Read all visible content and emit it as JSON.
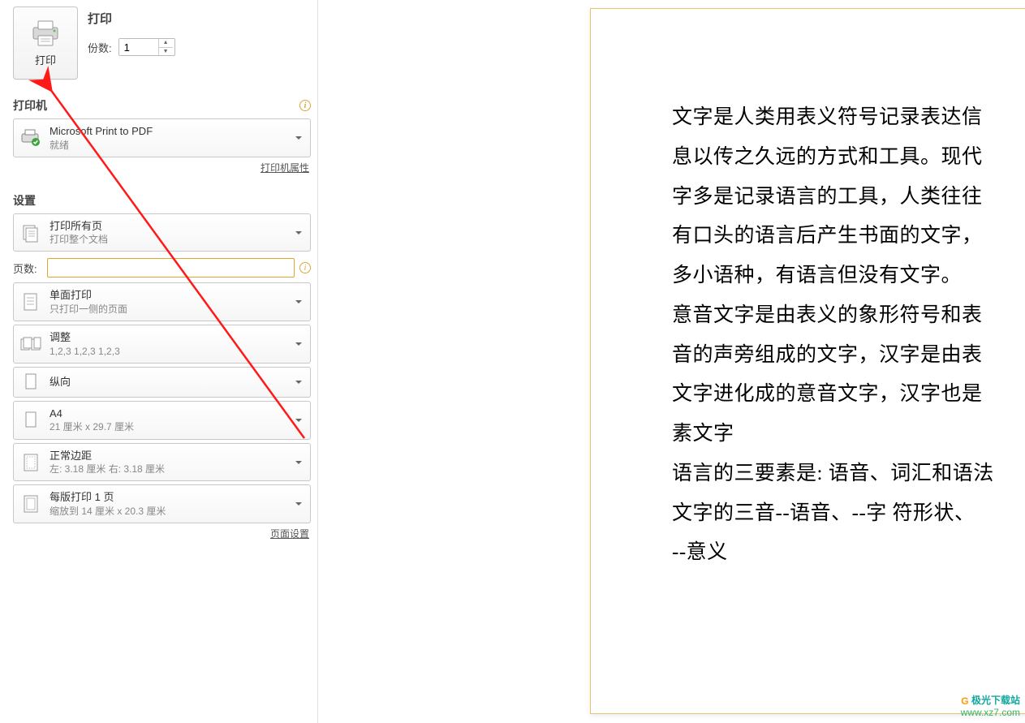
{
  "header": {
    "print_button_label": "打印",
    "title": "打印",
    "copies_label": "份数:",
    "copies_value": "1"
  },
  "printer": {
    "section_label": "打印机",
    "name": "Microsoft Print to PDF",
    "status": "就绪",
    "properties_link": "打印机属性"
  },
  "settings": {
    "section_label": "设置",
    "print_pages": {
      "primary": "打印所有页",
      "secondary": "打印整个文档"
    },
    "pages_label": "页数:",
    "pages_value": "",
    "single_side": {
      "primary": "单面打印",
      "secondary": "只打印一侧的页面"
    },
    "collate": {
      "primary": "调整",
      "secondary": "1,2,3    1,2,3    1,2,3"
    },
    "orientation": {
      "primary": "纵向"
    },
    "paper": {
      "primary": "A4",
      "secondary": "21 厘米 x 29.7 厘米"
    },
    "margins": {
      "primary": "正常边距",
      "secondary": "左: 3.18 厘米   右: 3.18 厘米"
    },
    "per_sheet": {
      "primary": "每版打印 1 页",
      "secondary": "缩放到 14 厘米 x 20.3 厘米"
    },
    "page_setup_link": "页面设置"
  },
  "document": {
    "lines": [
      "文字是人类用表义符号记录表达信",
      "息以传之久远的方式和工具。现代",
      "字多是记录语言的工具，人类往往",
      "有口头的语言后产生书面的文字，",
      "多小语种，有语言但没有文字。",
      "意音文字是由表义的象形符号和表",
      "音的声旁组成的文字，汉字是由表",
      "文字进化成的意音文字，汉字也是",
      "素文字",
      "语言的三要素是: 语音、词汇和语法",
      "文字的三音--语音、--字 符形状、",
      "--意义"
    ]
  },
  "watermark": {
    "brand_text": "极光下载站",
    "url": "www.xz7.com"
  }
}
